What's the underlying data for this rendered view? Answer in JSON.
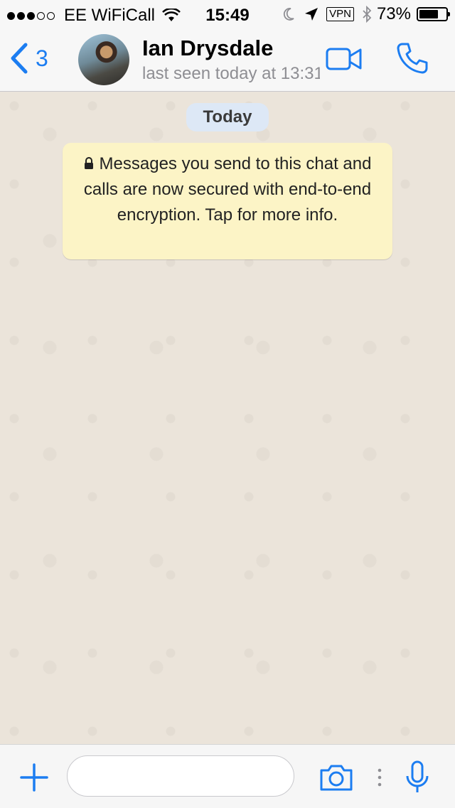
{
  "status_bar": {
    "carrier": "EE WiFiCall",
    "time": "15:49",
    "vpn": "VPN",
    "battery_percent": "73%",
    "battery_level": 0.73,
    "signal_bars": 3,
    "icons": [
      "wifi-icon",
      "moon-icon",
      "location-arrow-icon",
      "bluetooth-icon",
      "battery-icon"
    ]
  },
  "nav": {
    "back_count": "3",
    "contact_name": "Ian Drysdale",
    "contact_status": "last seen today at 13:31",
    "icons": [
      "back-chevron-icon",
      "video-camera-icon",
      "phone-icon"
    ]
  },
  "chat": {
    "date_label": "Today",
    "encryption_notice": "Messages you send to this chat and calls are now secured with end-to-end encryption. Tap for more info."
  },
  "input_bar": {
    "placeholder": "",
    "icons": [
      "plus-icon",
      "camera-icon",
      "more-dots-icon",
      "microphone-icon"
    ]
  },
  "colors": {
    "accent": "#1c7df1",
    "chat_background": "#ebe4da",
    "notice_background": "#fcf4c6",
    "date_pill": "#dde8f6"
  }
}
